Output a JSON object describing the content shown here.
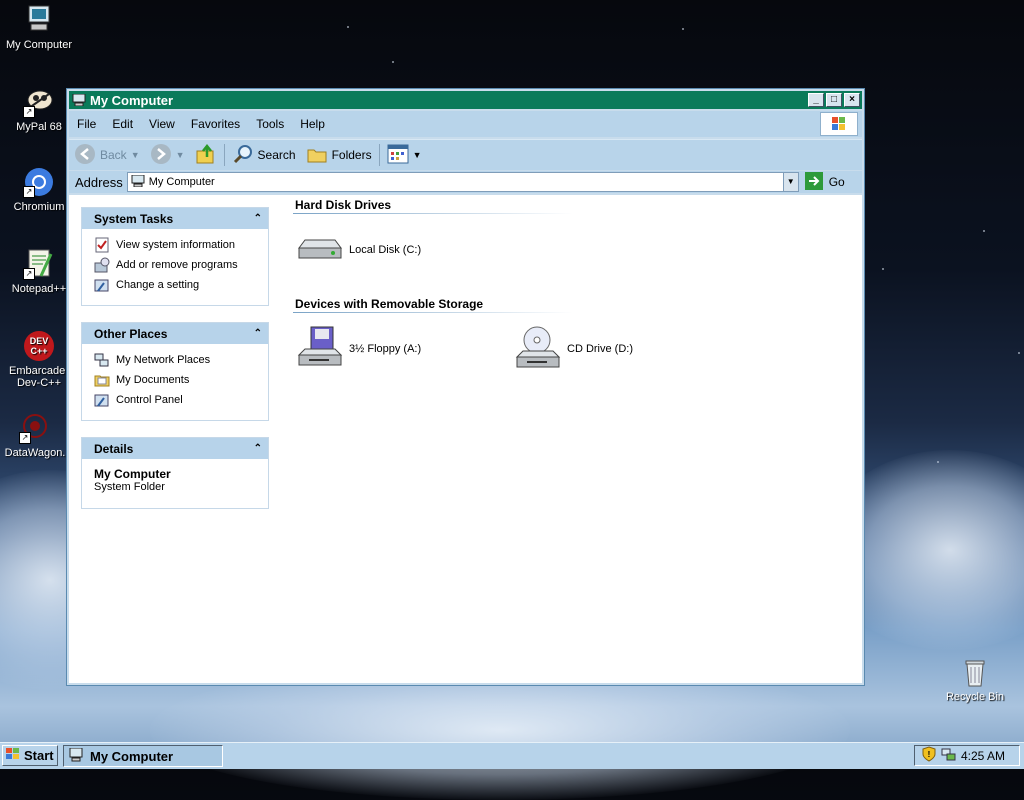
{
  "desktop": {
    "icons": [
      {
        "label": "My Computer",
        "icon": "my-computer-icon"
      },
      {
        "label": "MyPal 68",
        "icon": "mypal-icon"
      },
      {
        "label": "Chromium",
        "icon": "chromium-icon"
      },
      {
        "label": "Notepad++",
        "icon": "notepadpp-icon"
      },
      {
        "label": "Embarcader Dev-C++",
        "line1": "Embarcader",
        "line2": "Dev-C++",
        "icon": "devcpp-icon"
      },
      {
        "label": "DataWagon.",
        "icon": "datawagon-icon"
      },
      {
        "label": "Recycle Bin",
        "icon": "recycle-bin-icon"
      }
    ]
  },
  "window": {
    "title": "My Computer",
    "buttons": {
      "minimize": "_",
      "maximize": "□",
      "close": "×"
    },
    "menu": [
      "File",
      "Edit",
      "View",
      "Favorites",
      "Tools",
      "Help"
    ],
    "toolbar": {
      "back": "Back",
      "search": "Search",
      "folders": "Folders"
    },
    "address": {
      "label": "Address",
      "value": "My Computer",
      "go": "Go"
    }
  },
  "taskpane": {
    "system_tasks": {
      "title": "System Tasks",
      "items": [
        "View system information",
        "Add or remove programs",
        "Change a setting"
      ]
    },
    "other_places": {
      "title": "Other Places",
      "items": [
        "My Network Places",
        "My Documents",
        "Control Panel"
      ]
    },
    "details": {
      "title": "Details",
      "name": "My Computer",
      "type": "System Folder"
    }
  },
  "main": {
    "groups": [
      {
        "title": "Hard Disk Drives",
        "items": [
          "Local Disk (C:)"
        ]
      },
      {
        "title": "Devices with Removable Storage",
        "items": [
          "3½ Floppy (A:)",
          "CD Drive (D:)"
        ]
      }
    ]
  },
  "taskbar": {
    "start": "Start",
    "task": "My Computer",
    "clock": "4:25 AM"
  },
  "colors": {
    "titlebar": "#0a7a5a",
    "chrome": "#b8d4ea",
    "panel_header": "#b7d3ea"
  }
}
